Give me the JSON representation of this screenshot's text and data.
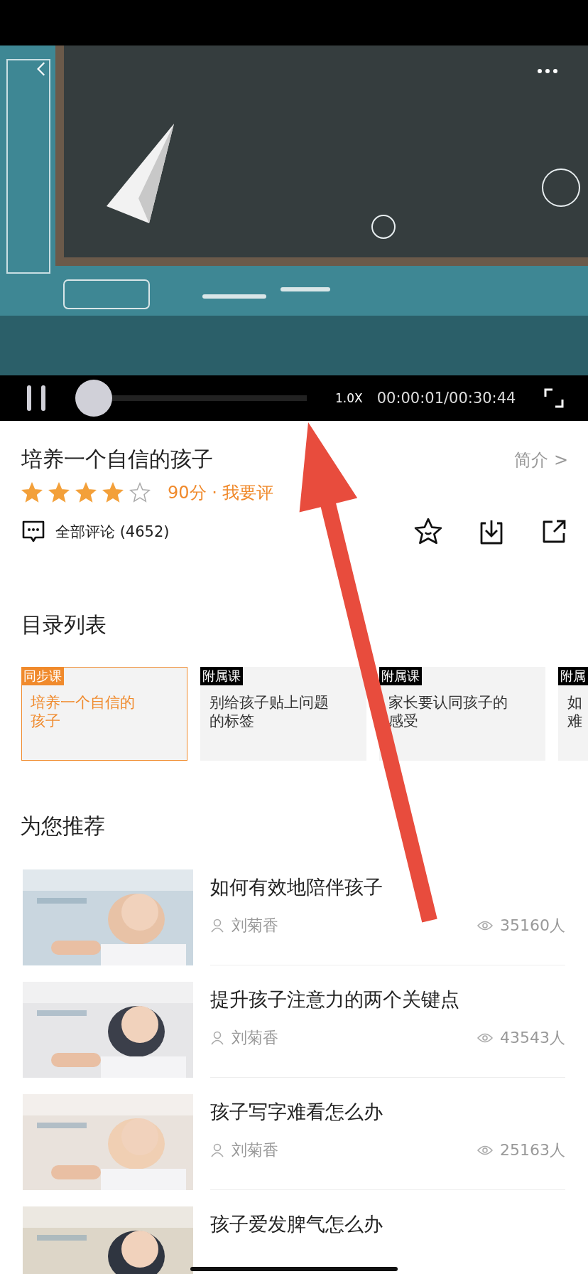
{
  "video": {
    "kind": "picture",
    "playing": true,
    "level": 0,
    "speed": "1.0X",
    "time": "00:00:01/00:30:44"
  },
  "course": {
    "title": "培养一个自信的孩子",
    "intro_link": "简介 >",
    "stars": 4,
    "score": "90分 · 我要评",
    "comments": "全部评论 (4652)"
  },
  "catalog": {
    "title": "目录列表",
    "items": [
      {
        "tag": "同步课",
        "lines": [
          "培养一个自信的",
          "孩子"
        ],
        "selected": true
      },
      {
        "tag": "附属课",
        "lines": [
          "别给孩子贴上问题",
          "的标签"
        ],
        "selected": false
      },
      {
        "tag": "附属课",
        "lines": [
          "家长要认同孩子的",
          "感受"
        ],
        "selected": false
      },
      {
        "tag": "附属",
        "lines": [
          "如",
          "难"
        ],
        "selected": false
      }
    ]
  },
  "recommended": {
    "title": "为您推荐",
    "items": [
      {
        "kind": "picture",
        "title": "如何有效地陪伴孩子",
        "author": "刘菊香",
        "views": "35160人"
      },
      {
        "kind": "picture",
        "title": "提升孩子注意力的两个关键点",
        "author": "刘菊香",
        "views": "43543人"
      },
      {
        "kind": "picture",
        "title": "孩子写字难看怎么办",
        "author": "刘菊香",
        "views": "25163人"
      },
      {
        "kind": "picture",
        "title": "孩子爱发脾气怎么办"
      }
    ]
  }
}
